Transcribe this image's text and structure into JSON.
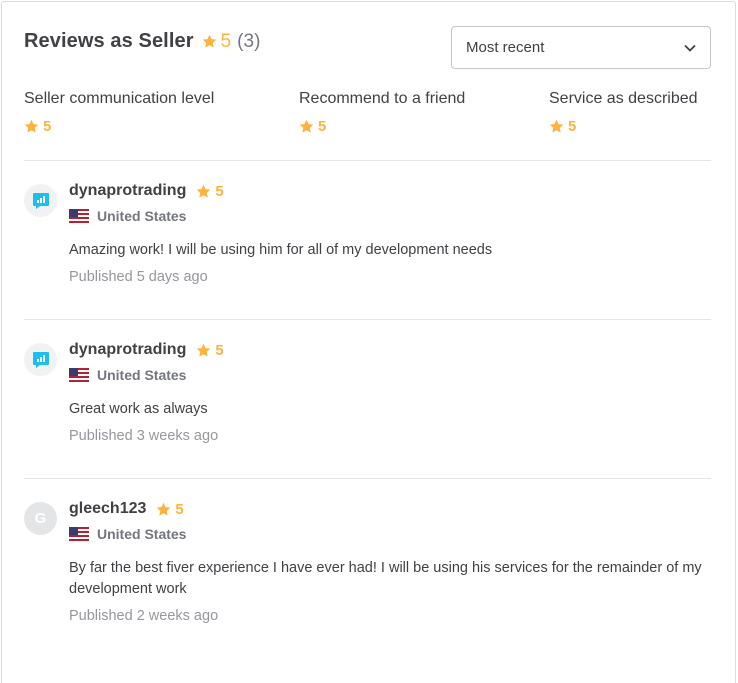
{
  "header": {
    "title": "Reviews as Seller",
    "score": "5",
    "count": "(3)"
  },
  "sort": {
    "selected": "Most recent"
  },
  "breakdown": [
    {
      "label": "Seller communication level",
      "score": "5"
    },
    {
      "label": "Recommend to a friend",
      "score": "5"
    },
    {
      "label": "Service as described",
      "score": "5"
    }
  ],
  "reviews": [
    {
      "username": "dynaprotrading",
      "score": "5",
      "country": "United States",
      "text": "Amazing work! I will be using him for all of my development needs",
      "date": "Published 5 days ago",
      "avatar": "chart-logo-icon"
    },
    {
      "username": "dynaprotrading",
      "score": "5",
      "country": "United States",
      "text": "Great work as always",
      "date": "Published 3 weeks ago",
      "avatar": "chart-logo-icon"
    },
    {
      "username": "gleech123",
      "score": "5",
      "country": "United States",
      "text": "By far the best fiver experience I have ever had! I will be using his services for the remainder of my development work",
      "date": "Published 2 weeks ago",
      "avatar_letter": "G"
    }
  ],
  "colors": {
    "star": "#ffb33e",
    "text": "#404145",
    "muted": "#74767e",
    "avatar_logo": "#1dbfef"
  }
}
